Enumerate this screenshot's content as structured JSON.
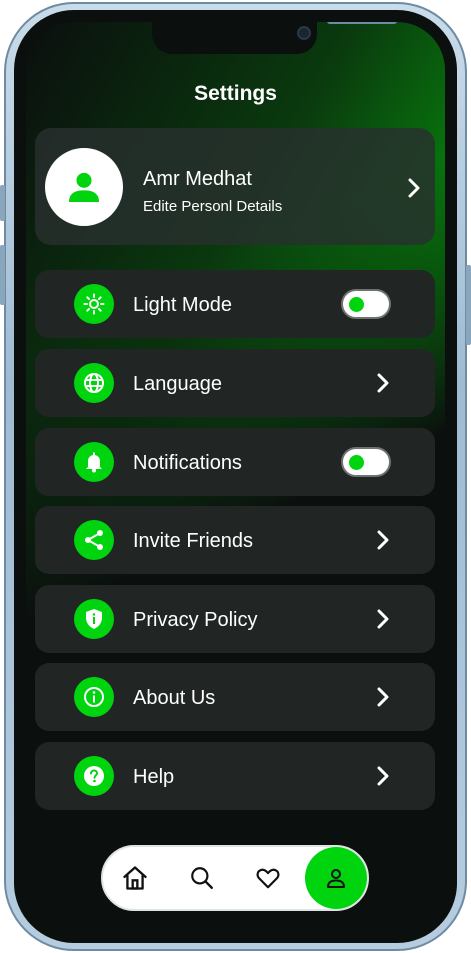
{
  "header": {
    "title": "Settings"
  },
  "profile": {
    "name": "Amr Medhat",
    "subtitle": "Edite Personl Details"
  },
  "settings": [
    {
      "label": "Light Mode",
      "icon": "sun-icon",
      "control": "toggle"
    },
    {
      "label": "Language",
      "icon": "globe-icon",
      "control": "chevron"
    },
    {
      "label": "Notifications",
      "icon": "bell-icon",
      "control": "toggle"
    },
    {
      "label": "Invite Friends",
      "icon": "share-icon",
      "control": "chevron"
    },
    {
      "label": "Privacy Policy",
      "icon": "shield-icon",
      "control": "chevron"
    },
    {
      "label": "About Us",
      "icon": "info-icon",
      "control": "chevron"
    },
    {
      "label": "Help",
      "icon": "help-icon",
      "control": "chevron"
    }
  ],
  "bottom_nav": [
    {
      "icon": "home-icon",
      "active": false
    },
    {
      "icon": "search-icon",
      "active": false
    },
    {
      "icon": "heart-icon",
      "active": false
    },
    {
      "icon": "profile-icon",
      "active": true
    }
  ],
  "colors": {
    "accent": "#00d40f",
    "card": "#212624",
    "background": "#0b0f0e"
  }
}
